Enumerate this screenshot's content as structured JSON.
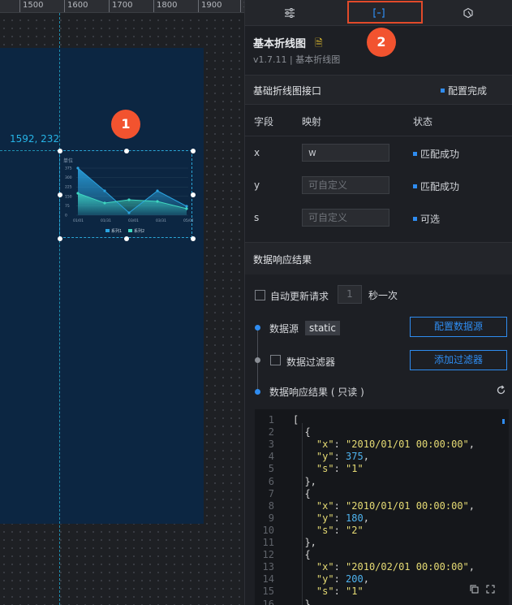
{
  "ruler": {
    "ticks": [
      "1500",
      "1600",
      "1700",
      "1800",
      "1900",
      "2"
    ]
  },
  "canvas": {
    "coord_label": "1592, 232",
    "badge1": "1"
  },
  "mini_chart": {
    "ylabel": "单位",
    "yticks": [
      "375",
      "300",
      "225",
      "150",
      "75",
      "0"
    ],
    "xticks": [
      "01/01",
      "01/31",
      "03/01",
      "03/31",
      "05/01"
    ],
    "legend": [
      "系列1",
      "系列2"
    ],
    "colors": {
      "series1": "#2aa3e0",
      "series2": "#3fd6c0"
    }
  },
  "tabs": {
    "badge2": "2",
    "items": [
      "settings-icon",
      "data-icon",
      "interaction-icon"
    ]
  },
  "component": {
    "title": "基本折线图",
    "version": "v1.7.11 | 基本折线图"
  },
  "interface": {
    "title": "基础折线图接口",
    "status": "配置完成"
  },
  "table": {
    "headers": [
      "字段",
      "映射",
      "状态"
    ],
    "rows": [
      {
        "field": "x",
        "value": "w",
        "placeholder": "",
        "status": "匹配成功"
      },
      {
        "field": "y",
        "value": "",
        "placeholder": "可自定义",
        "status": "匹配成功"
      },
      {
        "field": "s",
        "value": "",
        "placeholder": "可自定义",
        "status": "可选"
      }
    ]
  },
  "response": {
    "title": "数据响应结果",
    "auto_update": "自动更新请求",
    "interval": "1",
    "interval_unit": "秒一次",
    "source_label": "数据源",
    "source_tag": "static",
    "config_source": "配置数据源",
    "filter_label": "数据过滤器",
    "add_filter": "添加过滤器",
    "result_label": "数据响应结果 ( 只读 )"
  },
  "code": {
    "line_numbers": [
      "1",
      "2",
      "3",
      "4",
      "5",
      "6",
      "7",
      "8",
      "9",
      "10",
      "11",
      "12",
      "13",
      "14",
      "15",
      "16"
    ],
    "lines": [
      [
        [
          "k",
          "["
        ]
      ],
      [
        [
          "k",
          "  {"
        ]
      ],
      [
        [
          "k",
          "    "
        ],
        [
          "s",
          "\"x\""
        ],
        [
          "k",
          ": "
        ],
        [
          "s",
          "\"2010/01/01 00:00:00\""
        ],
        [
          "k",
          ","
        ]
      ],
      [
        [
          "k",
          "    "
        ],
        [
          "s",
          "\"y\""
        ],
        [
          "k",
          ": "
        ],
        [
          "n",
          "375"
        ],
        [
          "k",
          ","
        ]
      ],
      [
        [
          "k",
          "    "
        ],
        [
          "s",
          "\"s\""
        ],
        [
          "k",
          ": "
        ],
        [
          "s",
          "\"1\""
        ]
      ],
      [
        [
          "k",
          "  },"
        ]
      ],
      [
        [
          "k",
          "  {"
        ]
      ],
      [
        [
          "k",
          "    "
        ],
        [
          "s",
          "\"x\""
        ],
        [
          "k",
          ": "
        ],
        [
          "s",
          "\"2010/01/01 00:00:00\""
        ],
        [
          "k",
          ","
        ]
      ],
      [
        [
          "k",
          "    "
        ],
        [
          "s",
          "\"y\""
        ],
        [
          "k",
          ": "
        ],
        [
          "n",
          "180"
        ],
        [
          "k",
          ","
        ]
      ],
      [
        [
          "k",
          "    "
        ],
        [
          "s",
          "\"s\""
        ],
        [
          "k",
          ": "
        ],
        [
          "s",
          "\"2\""
        ]
      ],
      [
        [
          "k",
          "  },"
        ]
      ],
      [
        [
          "k",
          "  {"
        ]
      ],
      [
        [
          "k",
          "    "
        ],
        [
          "s",
          "\"x\""
        ],
        [
          "k",
          ": "
        ],
        [
          "s",
          "\"2010/02/01 00:00:00\""
        ],
        [
          "k",
          ","
        ]
      ],
      [
        [
          "k",
          "    "
        ],
        [
          "s",
          "\"y\""
        ],
        [
          "k",
          ": "
        ],
        [
          "n",
          "200"
        ],
        [
          "k",
          ","
        ]
      ],
      [
        [
          "k",
          "    "
        ],
        [
          "s",
          "\"s\""
        ],
        [
          "k",
          ": "
        ],
        [
          "s",
          "\"1\""
        ]
      ],
      [
        [
          "k",
          "  },"
        ]
      ]
    ]
  }
}
